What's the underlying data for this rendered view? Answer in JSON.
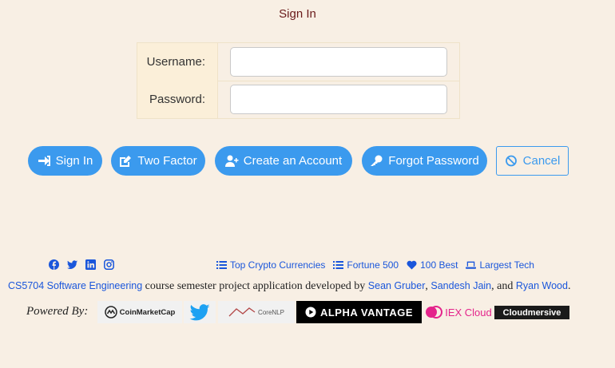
{
  "page": {
    "title": "Sign In"
  },
  "form": {
    "username_label": "Username:",
    "password_label": "Password:",
    "username_value": "",
    "password_value": ""
  },
  "buttons": {
    "sign_in": "Sign In",
    "two_factor": "Two Factor",
    "create_account": "Create an Account",
    "forgot_password": "Forgot Password",
    "cancel": "Cancel"
  },
  "footer": {
    "social_icons": [
      "facebook-icon",
      "twitter-icon",
      "linkedin-icon",
      "instagram-icon"
    ],
    "links": {
      "crypto": "Top Crypto Currencies",
      "fortune": "Fortune 500",
      "best": "100 Best",
      "tech": "Largest Tech"
    },
    "credits": {
      "course": "CS5704 Software Engineering",
      "middle": " course semester project application developed by ",
      "author1": "Sean Gruber",
      "sep1": ", ",
      "author2": "Sandesh Jain",
      "sep2": ", and ",
      "author3": "Ryan Wood",
      "end": "."
    },
    "powered_by": "Powered By:",
    "logos": {
      "coinmarketcap": "CoinMarketCap",
      "corenlp": "CoreNLP",
      "alphavantage": "ALPHA VANTAGE",
      "iex": "IEX Cloud",
      "cloudmersive": "Cloudmersive"
    }
  },
  "colors": {
    "accent": "#3b9aee",
    "background": "#f8efe4",
    "link": "#1a56db"
  }
}
